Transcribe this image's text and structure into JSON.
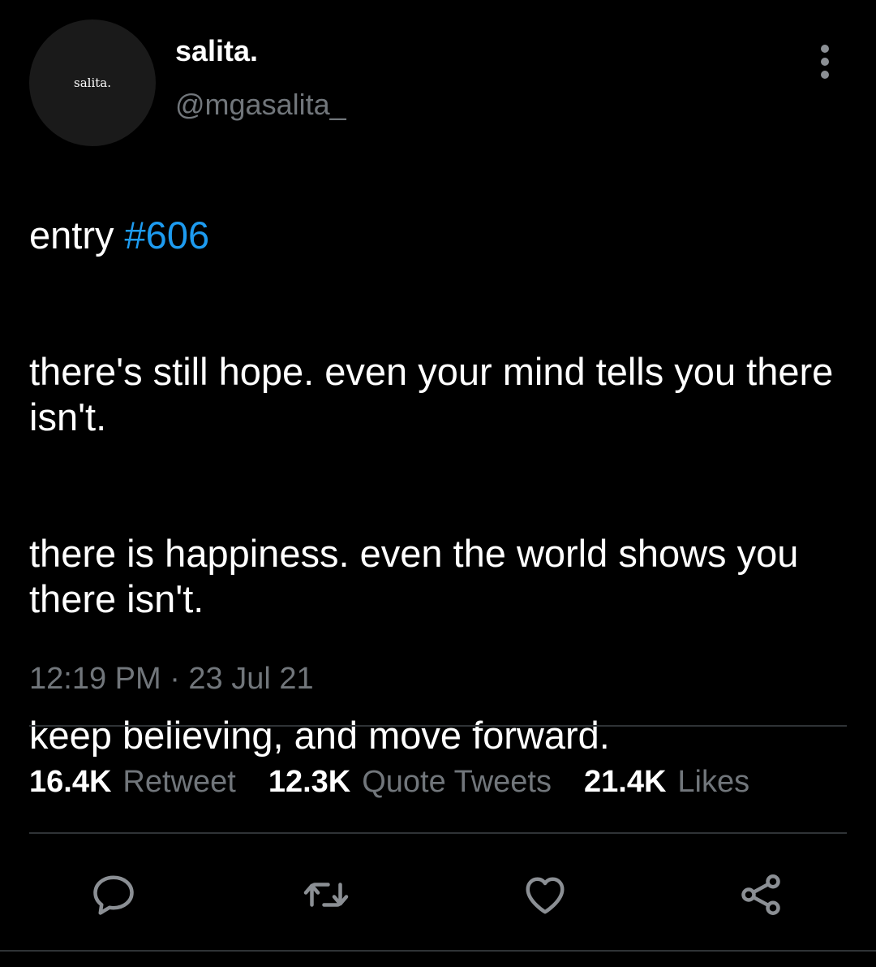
{
  "user": {
    "avatar_text": "salita.",
    "display_name": "salita.",
    "handle": "@mgasalita_"
  },
  "tweet": {
    "entry_prefix": "entry ",
    "hashtag": "#606",
    "paragraph_1": "there's still hope. even your mind tells you there isn't.",
    "paragraph_2": "there is happiness. even the world shows you there isn't.",
    "paragraph_3": "keep believing, and move forward.",
    "timestamp": "12:19 PM · 23 Jul 21"
  },
  "stats": {
    "retweets_count": "16.4K",
    "retweets_label": "Retweet",
    "quotes_count": "12.3K",
    "quotes_label": "Quote Tweets",
    "likes_count": "21.4K",
    "likes_label": "Likes"
  },
  "icons": {
    "more": "more-vertical-icon",
    "reply": "reply-icon",
    "retweet": "retweet-icon",
    "like": "heart-icon",
    "share": "share-icon"
  },
  "colors": {
    "background": "#000000",
    "text": "#ffffff",
    "secondary": "#71767b",
    "link": "#1d9bf0",
    "divider": "#2f3336"
  }
}
